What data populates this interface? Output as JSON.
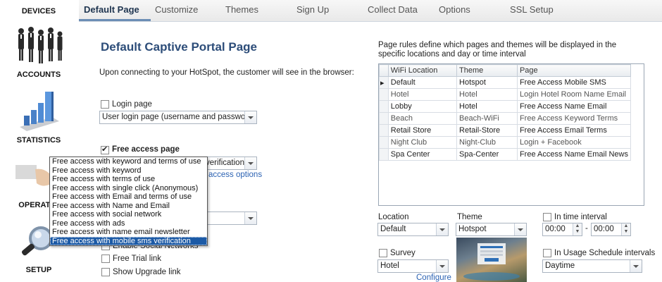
{
  "sidebar": {
    "items": [
      {
        "label": "DEVICES"
      },
      {
        "label": "ACCOUNTS"
      },
      {
        "label": "STATISTICS"
      },
      {
        "label": "OPERATO"
      },
      {
        "label": "SETUP"
      }
    ]
  },
  "tabs": [
    {
      "label": "Default Page"
    },
    {
      "label": "Customize"
    },
    {
      "label": "Themes"
    },
    {
      "label": "Sign Up"
    },
    {
      "label": "Collect Data"
    },
    {
      "label": "Options"
    },
    {
      "label": "SSL Setup"
    }
  ],
  "main": {
    "title": "Default Captive Portal Page",
    "intro": "Upon connecting to your HotSpot, the customer will see in the browser:",
    "login_page_label": "Login page",
    "login_page_select": "User login page (username and password)",
    "free_access_label": "Free access page",
    "free_access_select_visible": "verification",
    "access_options_link": "access options",
    "enable_social_label": "Enable Social Networks",
    "free_trial_label": "Free Trial link",
    "show_upgrade_label": "Show Upgrade link"
  },
  "dropdown": {
    "options": [
      "Free access with keyword and terms of use",
      "Free access with keyword",
      "Free access with terms of use",
      "Free access with single click (Anonymous)",
      "Free access with Email and terms of use",
      "Free access with Name and Email",
      "Free access with social network",
      "Free access with ads",
      "Free access with name email newsletter",
      "Free access with mobile sms verification"
    ],
    "selected_index": 9
  },
  "rules": {
    "description": "Page rules define which pages and themes will be displayed in the specific locations and day or time interval",
    "columns": [
      "WiFi Location",
      "Theme",
      "Page"
    ],
    "rows": [
      {
        "location": "Default",
        "theme": "Hotspot",
        "page": "Free Access Mobile SMS"
      },
      {
        "location": "Hotel",
        "theme": "Hotel",
        "page": "Login Hotel Room Name Email"
      },
      {
        "location": "Lobby",
        "theme": "Hotel",
        "page": "Free Access Name Email"
      },
      {
        "location": "Beach",
        "theme": "Beach-WiFi",
        "page": "Free Access Keyword Terms"
      },
      {
        "location": "Retail Store",
        "theme": "Retail-Store",
        "page": "Free Access Email Terms"
      },
      {
        "location": "Night Club",
        "theme": "Night-Club",
        "page": "Login + Facebook"
      },
      {
        "location": "Spa Center",
        "theme": "Spa-Center",
        "page": "Free Access Name Email News"
      }
    ]
  },
  "editor": {
    "location_label": "Location",
    "location_value": "Default",
    "theme_label": "Theme",
    "theme_value": "Hotspot",
    "interval_label": "In time interval",
    "time_from": "00:00",
    "time_sep": "-",
    "time_to": "00:00",
    "survey_label": "Survey",
    "survey_value": "Hotel",
    "configure_link": "Configure",
    "usage_label": "In Usage Schedule intervals",
    "usage_value": "Daytime"
  }
}
